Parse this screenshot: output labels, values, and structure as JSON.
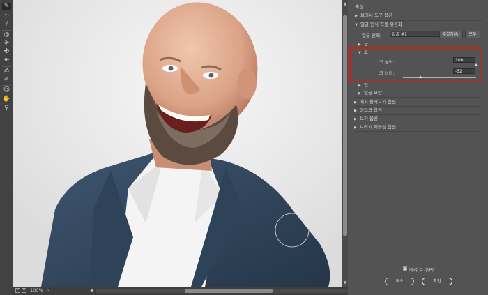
{
  "panel": {
    "title": "속성",
    "sections": [
      {
        "label": "브러시 도구 옵션",
        "state": "collapsed"
      },
      {
        "label": "얼굴 인식 픽셀 유동화",
        "state": "expanded"
      },
      {
        "label": "눈",
        "state": "collapsed"
      },
      {
        "label": "코",
        "state": "expanded"
      },
      {
        "label": "입",
        "state": "collapsed"
      },
      {
        "label": "얼굴 모양",
        "state": "collapsed"
      },
      {
        "label": "메시 불러오기 옵션",
        "state": "collapsed"
      },
      {
        "label": "마스크 옵션",
        "state": "collapsed"
      },
      {
        "label": "보기 옵션",
        "state": "collapsed"
      },
      {
        "label": "브러시 재구성 옵션",
        "state": "collapsed"
      }
    ],
    "face_select": {
      "label": "얼굴 선택:",
      "value": "얼굴 #1"
    },
    "reset_button": "재설정(R)",
    "all_button": "모두",
    "nose": {
      "height": {
        "label": "코 높이:",
        "value": "100",
        "fraction": 1.0
      },
      "width": {
        "label": "코 너비:",
        "value": "-52",
        "fraction": 0.24
      }
    },
    "preview": {
      "label": "미리 보기(P)",
      "checked": true
    },
    "cancel_button": "취소",
    "ok_button": "확인"
  },
  "status": {
    "zoom": "100%"
  },
  "colors": {
    "highlight": "#d11c1c",
    "panel_bg": "#535353",
    "toolbar_bg": "#424242"
  },
  "tools": [
    "forward-warp-icon",
    "reconstruct-icon",
    "smooth-icon",
    "twirl-icon",
    "pucker-icon",
    "bloat-icon",
    "push-left-icon",
    "freeze-mask-icon",
    "thaw-mask-icon",
    "face-tool-icon",
    "hand-icon",
    "zoom-icon"
  ]
}
